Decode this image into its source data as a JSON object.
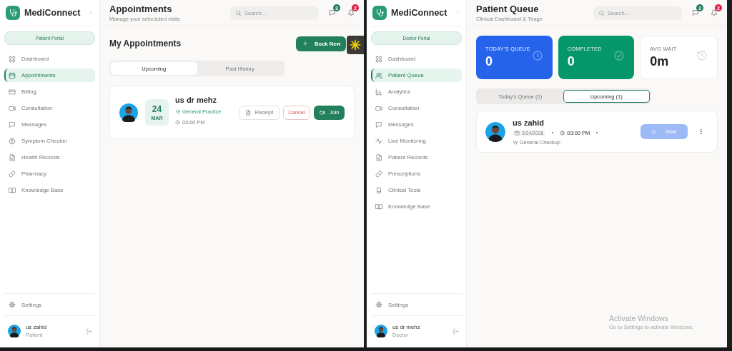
{
  "windows": [
    {
      "kind": "patient",
      "brand": "MediConnect",
      "portal": "Patient Portal",
      "nav": [
        {
          "label": "Dashboard",
          "selected": false
        },
        {
          "label": "Appointments",
          "selected": true
        },
        {
          "label": "Billing",
          "selected": false
        },
        {
          "label": "Consultation",
          "selected": false
        },
        {
          "label": "Messages",
          "selected": false
        },
        {
          "label": "Symptom Checker",
          "selected": false
        },
        {
          "label": "Health Records",
          "selected": false
        },
        {
          "label": "Pharmacy",
          "selected": false
        },
        {
          "label": "Knowledge Base",
          "selected": false
        }
      ],
      "settings": "Settings",
      "user": {
        "name": "us zahid",
        "role": "Patient"
      },
      "header": {
        "title": "Appointments",
        "subtitle": "Manage your scheduled visits",
        "search_placeholder": "Search...",
        "messages_badge": "3",
        "notifications_badge": "2"
      },
      "content": {
        "heading": "My Appointments",
        "book_button": "Book New",
        "tabs": [
          {
            "label": "Upcoming",
            "selected": true
          },
          {
            "label": "Past History",
            "selected": false
          }
        ],
        "appointments": [
          {
            "name": "us dr mehz",
            "day": "24",
            "month": "MAR",
            "specialty": "General Practice",
            "time": "03:00 PM",
            "receipt": "Receipt",
            "cancel": "Cancel",
            "join": "Join"
          }
        ]
      }
    },
    {
      "kind": "doctor",
      "brand": "MediConnect",
      "portal": "Doctor Portal",
      "nav": [
        {
          "label": "Dashboard",
          "selected": false
        },
        {
          "label": "Patient Queue",
          "selected": true
        },
        {
          "label": "Analytics",
          "selected": false
        },
        {
          "label": "Consultation",
          "selected": false
        },
        {
          "label": "Messages",
          "selected": false
        },
        {
          "label": "Live Monitoring",
          "selected": false
        },
        {
          "label": "Patient Records",
          "selected": false
        },
        {
          "label": "Prescriptions",
          "selected": false
        },
        {
          "label": "Clinical Tools",
          "selected": false
        },
        {
          "label": "Knowledge Base",
          "selected": false
        }
      ],
      "settings": "Settings",
      "user": {
        "name": "us dr mehz",
        "role": "Doctor"
      },
      "header": {
        "title": "Patient Queue",
        "subtitle": "Clinical Dashboard & Triage",
        "search_placeholder": "Search...",
        "messages_badge": "3",
        "notifications_badge": "2"
      },
      "content": {
        "stats": [
          {
            "kind": "blue",
            "label": "TODAY'S QUEUE",
            "value": "0"
          },
          {
            "kind": "green",
            "label": "COMPLETED",
            "value": "0"
          },
          {
            "kind": "plain",
            "label": "AVG WAIT",
            "value": "0m"
          }
        ],
        "tabs": [
          {
            "label": "Today's Queue (0)",
            "selected": false
          },
          {
            "label": "Upcoming (1)",
            "selected": true
          }
        ],
        "queue": [
          {
            "name": "us zahid",
            "date": "3/24/2026",
            "time": "03:00 PM",
            "reason": "General Checkup",
            "start": "Start",
            "disabled": true
          }
        ]
      },
      "os_notice": {
        "title": "Activate Windows",
        "text": "Go to Settings to activate Windows."
      }
    }
  ]
}
